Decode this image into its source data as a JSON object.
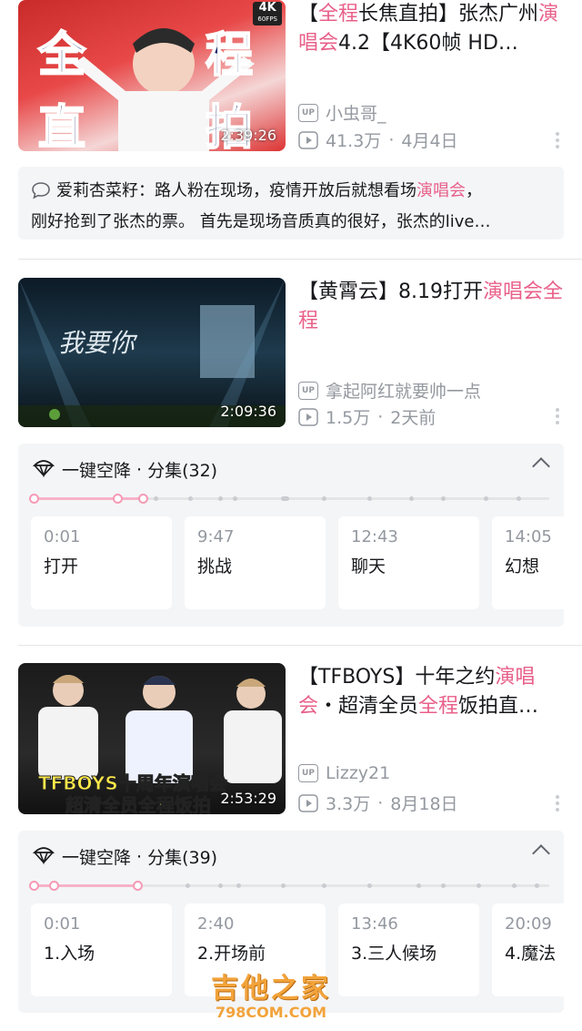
{
  "videos": [
    {
      "thumb_big_text": [
        "全",
        "程",
        "直",
        "拍"
      ],
      "thumb_badge": "4K",
      "thumb_badge_sub": "60FPS",
      "duration": "2:39:26",
      "title_parts": [
        {
          "t": "【",
          "hl": false
        },
        {
          "t": "全程",
          "hl": true
        },
        {
          "t": "长焦直拍】张杰广州",
          "hl": false
        },
        {
          "t": "演唱会",
          "hl": true
        },
        {
          "t": "4.2【4K60帧 HD…",
          "hl": false
        }
      ],
      "uploader": "小虫哥_",
      "views": "41.3万",
      "date": "4月4日"
    },
    {
      "thumb_text": "我要你",
      "duration": "2:09:36",
      "title_parts": [
        {
          "t": "【黄霄云】8.19打开",
          "hl": false
        },
        {
          "t": "演唱会",
          "hl": true
        },
        {
          "t": "全程",
          "hl": true
        }
      ],
      "uploader": "拿起阿红就要帅一点",
      "views": "1.5万",
      "date": "2天前"
    },
    {
      "thumb_caption_1": "TFBOYS十周年演唱会",
      "thumb_caption_2": "超清全员全程饭拍",
      "duration": "2:53:29",
      "title_parts": [
        {
          "t": "【TFBOYS】十年之约",
          "hl": false
        },
        {
          "t": "演唱会",
          "hl": true
        },
        {
          "t": "・超清全员",
          "hl": false
        },
        {
          "t": "全程",
          "hl": true
        },
        {
          "t": "饭拍直…",
          "hl": false
        }
      ],
      "uploader": "Lizzy21",
      "views": "3.3万",
      "date": "8月18日"
    }
  ],
  "up_badge": "UP",
  "meta_separator": "·",
  "comment": {
    "user": "爱莉杏菜籽：",
    "line1_pre": "路人粉在现场，疫情开放后就想看场",
    "line1_hl": "演唱会",
    "line1_post": "，",
    "line2": "刚好抢到了张杰的票。 首先是现场音质真的很好，张杰的live…"
  },
  "panels": [
    {
      "label": "一键空降",
      "dot": "·",
      "count_label": "分集(32)",
      "progress": 0.22,
      "episodes": [
        {
          "time": "0:01",
          "name": "打开"
        },
        {
          "time": "9:47",
          "name": "挑战"
        },
        {
          "time": "12:43",
          "name": "聊天"
        },
        {
          "time": "14:05",
          "name": "幻想"
        }
      ]
    },
    {
      "label": "一键空降",
      "dot": "·",
      "count_label": "分集(39)",
      "progress": 0.2,
      "episodes": [
        {
          "time": "0:01",
          "name": "1.入场"
        },
        {
          "time": "2:40",
          "name": "2.开场前"
        },
        {
          "time": "13:46",
          "name": "3.三人候场"
        },
        {
          "time": "20:09",
          "name": "4.魔法"
        }
      ]
    }
  ],
  "watermark": {
    "line1": "吉他之家",
    "line2": "798COM.COM"
  },
  "colors": {
    "highlight": "#e8608a",
    "meta": "#9499a0",
    "panel_bg": "#f4f5f7",
    "progress": "#f7b3c8"
  }
}
